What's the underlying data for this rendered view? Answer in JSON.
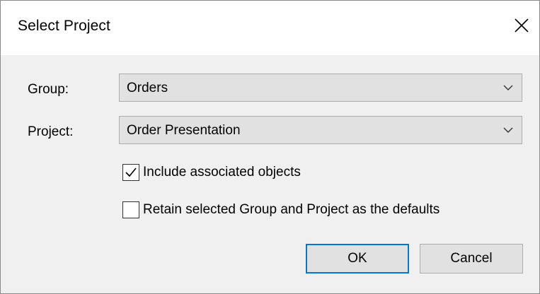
{
  "dialog": {
    "title": "Select Project",
    "close_icon": "close-icon"
  },
  "form": {
    "group_label": "Group:",
    "group_value": "Orders",
    "project_label": "Project:",
    "project_value": "Order Presentation",
    "dropdown_icon": "chevron-down-icon"
  },
  "options": {
    "include_associated": {
      "label": "Include associated objects",
      "checked": true
    },
    "retain_defaults": {
      "label": "Retain selected Group and Project as the defaults",
      "checked": false
    }
  },
  "buttons": {
    "ok_label": "OK",
    "cancel_label": "Cancel"
  },
  "colors": {
    "focus_accent": "#0078d7",
    "button_face": "#e1e1e1",
    "dialog_background": "#f0f0f0"
  }
}
